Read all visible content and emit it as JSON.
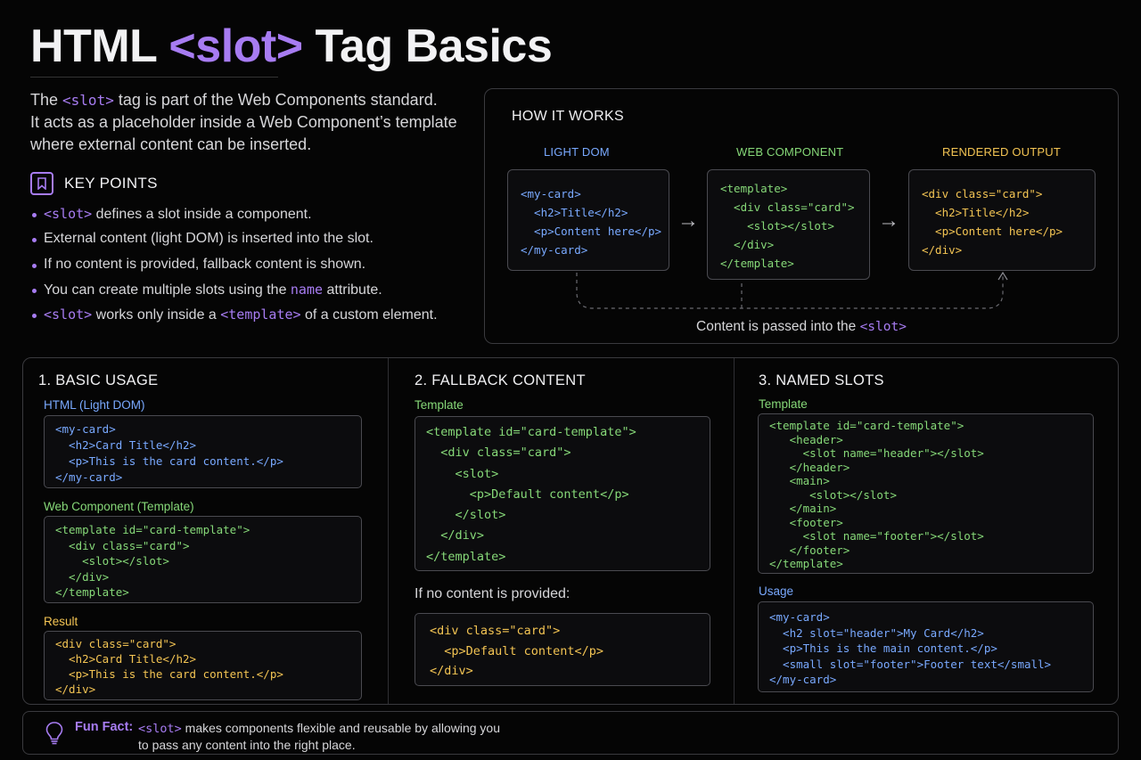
{
  "title": {
    "prefix": "HTML ",
    "tag": "<slot>",
    "suffix": " Tag Basics"
  },
  "intro": {
    "line1_pre": "The ",
    "line1_code": "<slot>",
    "line1_post": " tag is part of the Web Components standard.",
    "line2": "It acts as a placeholder inside a Web Component’s template",
    "line3": "where external content can be inserted."
  },
  "key_points": {
    "title": "KEY POINTS",
    "icon": "bookmark-icon",
    "p1_code": "<slot>",
    "p1_text": " defines a slot inside a component.",
    "p2_text": "External content (light DOM) is inserted into the slot.",
    "p3_text": "If no content is provided, fallback content is shown.",
    "p4_text": "You can create multiple slots using the ",
    "p4_code": "name",
    "p4_post": " attribute.",
    "p5_code": "<slot>",
    "p5_text": " works only inside a ",
    "p5_code2": "<template>",
    "p5_post": " of a custom element."
  },
  "how_it_works": {
    "title": "HOW IT WORKS",
    "labels": [
      "LIGHT DOM",
      "WEB COMPONENT",
      "RENDERED OUTPUT"
    ],
    "light_dom_code": "<my-card>\n  <h2>Title</h2>\n  <p>Content here</p>\n</my-card>",
    "component_code": "<template>\n  <div class=\"card\">\n    <slot></slot>\n  </div>\n</template>",
    "output_code": "<div class=\"card\">\n  <h2>Title</h2>\n  <p>Content here</p>\n</div>",
    "arrow": "→",
    "caption_pre": "Content is passed into the ",
    "caption_code": "<slot>"
  },
  "basic_usage": {
    "title": "1. BASIC USAGE",
    "html_label": "HTML (Light DOM)",
    "html_code": "<my-card>\n  <h2>Card Title</h2>\n  <p>This is the card content.</p>\n</my-card>",
    "component_label": "Web Component (Template)",
    "component_code": "<template id=\"card-template\">\n  <div class=\"card\">\n    <slot></slot>\n  </div>\n</template>",
    "result_label": "Result",
    "result_code": "<div class=\"card\">\n  <h2>Card Title</h2>\n  <p>This is the card content.</p>\n</div>"
  },
  "fallback": {
    "title": "2. FALLBACK CONTENT",
    "template_label": "Template",
    "template_code": "<template id=\"card-template\">\n  <div class=\"card\">\n    <slot>\n      <p>Default content</p>\n    </slot>\n  </div>\n</template>",
    "note": "If no content is provided:",
    "result_code": "<div class=\"card\">\n  <p>Default content</p>\n</div>"
  },
  "named_slots": {
    "title": "3. NAMED SLOTS",
    "template_label": "Template",
    "template_code": "<template id=\"card-template\">\n   <header>\n     <slot name=\"header\"></slot>\n   </header>\n   <main>\n      <slot></slot>\n   </main>\n   <footer>\n     <slot name=\"footer\"></slot>\n   </footer>\n</template>",
    "usage_label": "Usage",
    "usage_code": "<my-card>\n  <h2 slot=\"header\">My Card</h2>\n  <p>This is the main content.</p>\n  <small slot=\"footer\">Footer text</small>\n</my-card>"
  },
  "fun_fact": {
    "icon": "lightbulb-icon",
    "label": "Fun Fact:",
    "code": "<slot>",
    "line1_post": " makes components flexible and reusable by allowing you",
    "line2": "to pass any content into the right place."
  },
  "colors": {
    "accent_purple": "#a77cf2",
    "light_dom_blue": "#79a9ff",
    "component_green": "#86d878",
    "output_yellow": "#f3c453",
    "background": "#050505"
  }
}
